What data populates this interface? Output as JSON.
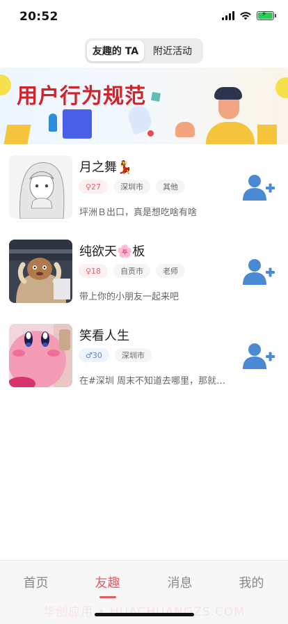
{
  "status_bar": {
    "time": "20:52"
  },
  "segment_tabs": [
    {
      "label": "友趣的 TA",
      "active": true
    },
    {
      "label": "附近活动",
      "active": false
    }
  ],
  "banner": {
    "title": "用户行为规范"
  },
  "users": [
    {
      "name": "月之舞💃",
      "gender_age": "♀27",
      "gender": "female",
      "city": "深圳市",
      "occupation": "其他",
      "bio": "坪洲Ｂ出口，真是想吃啥有啥"
    },
    {
      "name": "纯欲天🌸板",
      "gender_age": "♀18",
      "gender": "female",
      "city": "自贡市",
      "occupation": "老师",
      "bio": "带上你的小朋友一起来吧"
    },
    {
      "name": "笑看人生",
      "gender_age": "♂30",
      "gender": "male",
      "city": "深圳市",
      "occupation": "",
      "bio": "在#深圳 周末不知道去哪里，那就…"
    }
  ],
  "tabbar": {
    "items": [
      {
        "label": "首页",
        "active": false
      },
      {
        "label": "友趣",
        "active": true
      },
      {
        "label": "消息",
        "active": false
      },
      {
        "label": "我的",
        "active": false
      }
    ],
    "watermark": "华创应用 • HUACHUANGZS.COM"
  },
  "colors": {
    "accent": "#e25c63",
    "add_icon": "#4a8ad4",
    "banner_title": "#d2232a"
  }
}
